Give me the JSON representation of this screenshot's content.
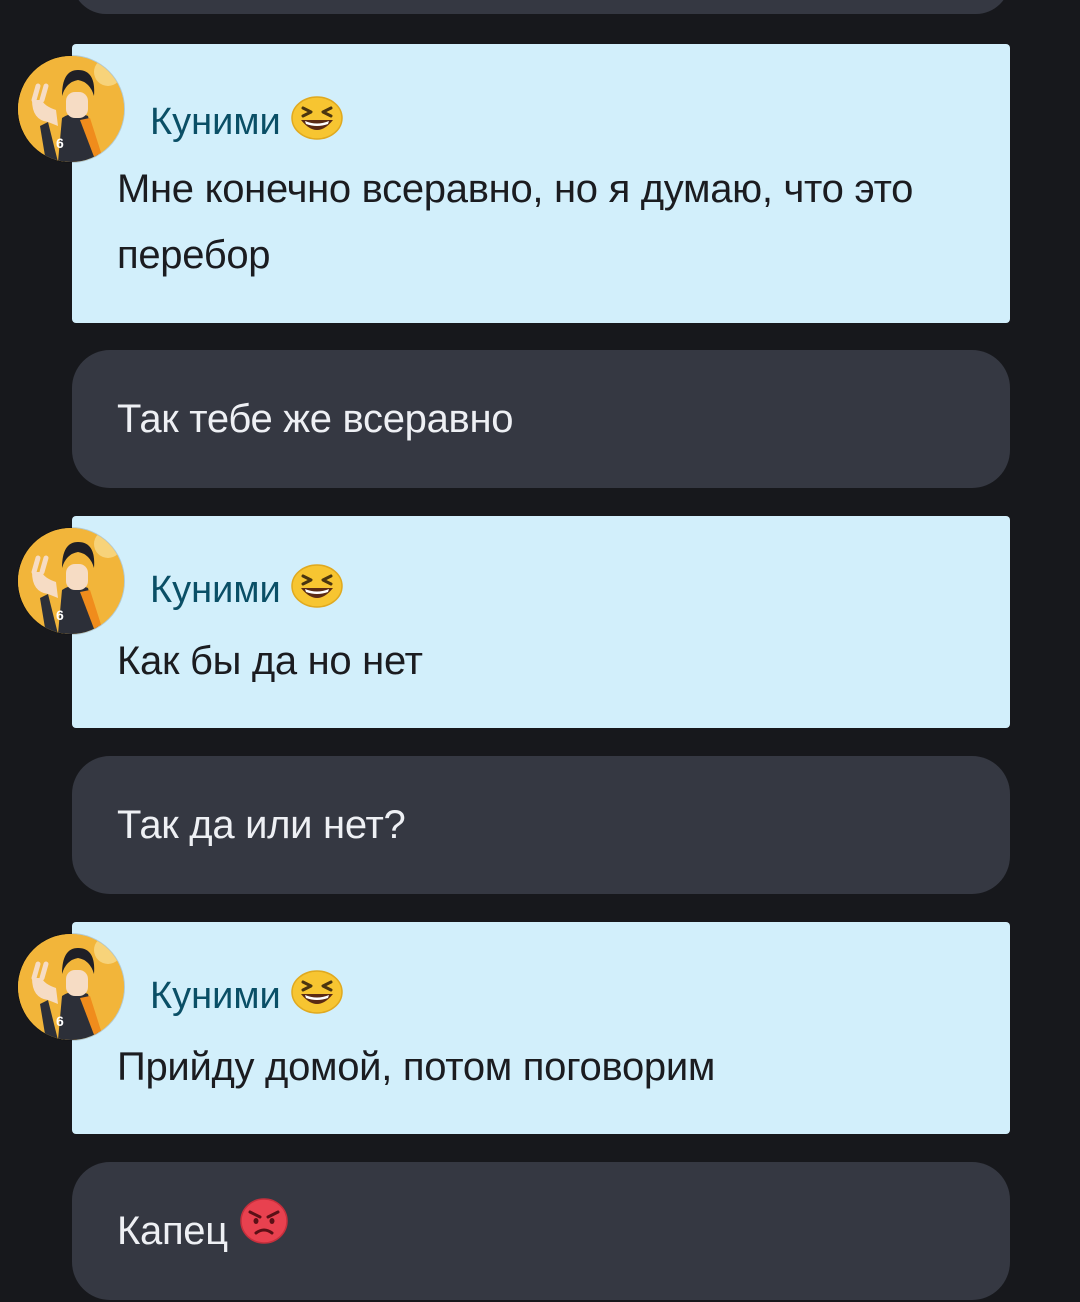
{
  "messages": [
    {
      "type": "incoming",
      "sender": "Куними",
      "sender_emoji": "laughing-face-emoji",
      "text": "Мне конечно всеравно, но я думаю, что это перебор"
    },
    {
      "type": "outgoing",
      "text": "Так тебе же всеравно"
    },
    {
      "type": "incoming",
      "sender": "Куними",
      "sender_emoji": "laughing-face-emoji",
      "text": "Как бы да но нет"
    },
    {
      "type": "outgoing",
      "text": "Так да или нет?"
    },
    {
      "type": "incoming",
      "sender": "Куними",
      "sender_emoji": "laughing-face-emoji",
      "text": "Прийду домой, потом поговорим"
    },
    {
      "type": "outgoing",
      "text": "Капец",
      "text_emoji": "angry-face-emoji"
    }
  ],
  "colors": {
    "background": "#17181c",
    "incoming_bubble": "#d2effb",
    "outgoing_bubble": "#353842",
    "sender_name": "#0a4f66",
    "incoming_text": "#1b1c20",
    "outgoing_text": "#eef0f4"
  }
}
